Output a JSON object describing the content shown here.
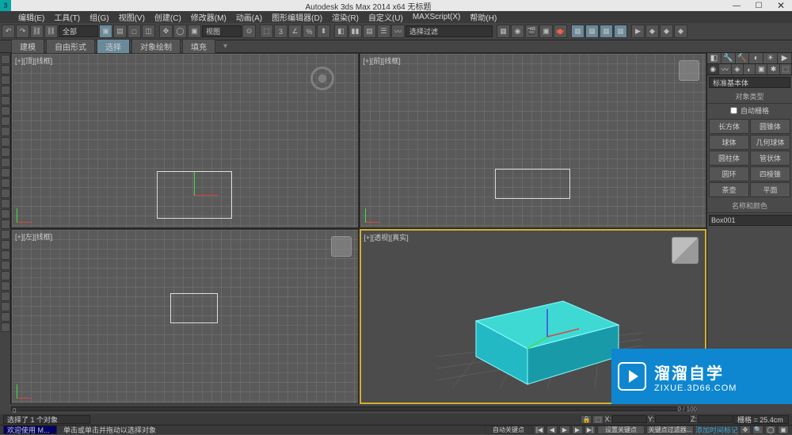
{
  "title": "Autodesk 3ds Max  2014 x64     无标题",
  "menu": [
    "编辑(E)",
    "工具(T)",
    "组(G)",
    "视图(V)",
    "创建(C)",
    "修改器(M)",
    "动画(A)",
    "图形编辑器(D)",
    "渲染(R)",
    "自定义(U)",
    "MAXScript(X)",
    "帮助(H)"
  ],
  "toolbar_sel1": "全部",
  "toolbar_sel2": "视图",
  "toolbar_sel3": "选择过滤",
  "ribbon": {
    "tabs": [
      "建模",
      "自由形式",
      "选择",
      "对象绘制",
      "填充"
    ],
    "active": 2
  },
  "viewports": {
    "tl": "[+][顶][线框]",
    "tr": "[+][前][线框]",
    "bl": "[+][左][线框]",
    "br": "[+][透视][真实]"
  },
  "cmd": {
    "dropdown": "标准基本体",
    "rollout1": "对象类型",
    "autogrid": "自动栅格",
    "primitives": [
      "长方体",
      "圆锥体",
      "球体",
      "几何球体",
      "圆柱体",
      "管状体",
      "圆环",
      "四棱锥",
      "茶壶",
      "平面"
    ],
    "rollout2": "名称和颜色",
    "name": "Box001"
  },
  "timeline": {
    "start": "0",
    "range": "0 / 100"
  },
  "status": {
    "sel": "选择了 1 个对象",
    "welcome": "欢迎使用 M...",
    "hint": "单击或单击并拖动以选择对象",
    "autokey": "自动关键点",
    "setkey": "设置关键点",
    "keyfilter": "关键点过滤器...",
    "grid": "栅格 = 25.4cm",
    "addtime": "添加时间标记"
  },
  "coords": {
    "x": "X:",
    "y": "Y:",
    "z": "Z:"
  },
  "watermark": {
    "main": "溜溜自学",
    "sub": "ZIXUE.3D66.COM"
  }
}
